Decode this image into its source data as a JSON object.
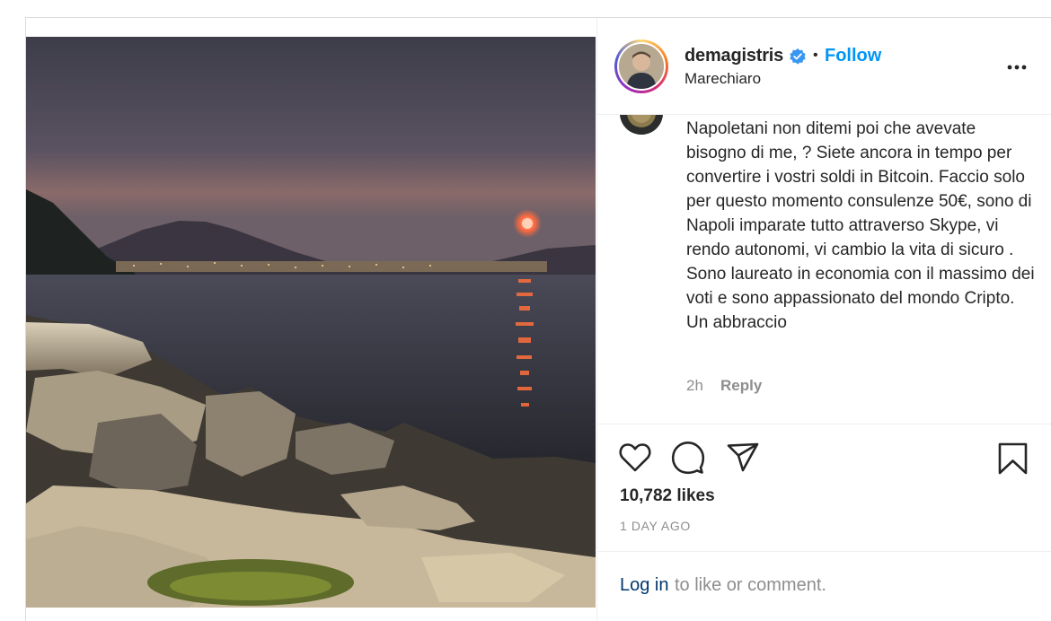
{
  "post": {
    "username": "demagistris",
    "follow_label": "Follow",
    "separator": "•",
    "location": "Marechiaro"
  },
  "comment": {
    "text": "Napoletani non ditemi poi che avevate bisogno di me, ? Siete ancora in tempo per convertire i vostri soldi in Bitcoin. Faccio solo per questo momento consulenze 50€, sono di Napoli imparate tutto attraverso Skype, vi rendo autonomi, vi cambio la vita di sicuro . Sono laureato in economia con il massimo dei voti e sono appassionato del mondo Cripto. Un abbraccio",
    "time": "2h",
    "reply_label": "Reply"
  },
  "stats": {
    "likes": "10,782 likes",
    "posted": "1 DAY AGO"
  },
  "login": {
    "link": "Log in",
    "rest": "to like or comment."
  },
  "icons": {
    "like": "heart-icon",
    "comment": "comment-icon",
    "share": "share-icon",
    "save": "bookmark-icon",
    "more": "more-options-icon",
    "verified": "verified-badge-icon"
  },
  "colors": {
    "accent": "#0095f6",
    "text": "#262626",
    "muted": "#8e8e8e",
    "link": "#00376b",
    "border": "#dbdbdb"
  }
}
